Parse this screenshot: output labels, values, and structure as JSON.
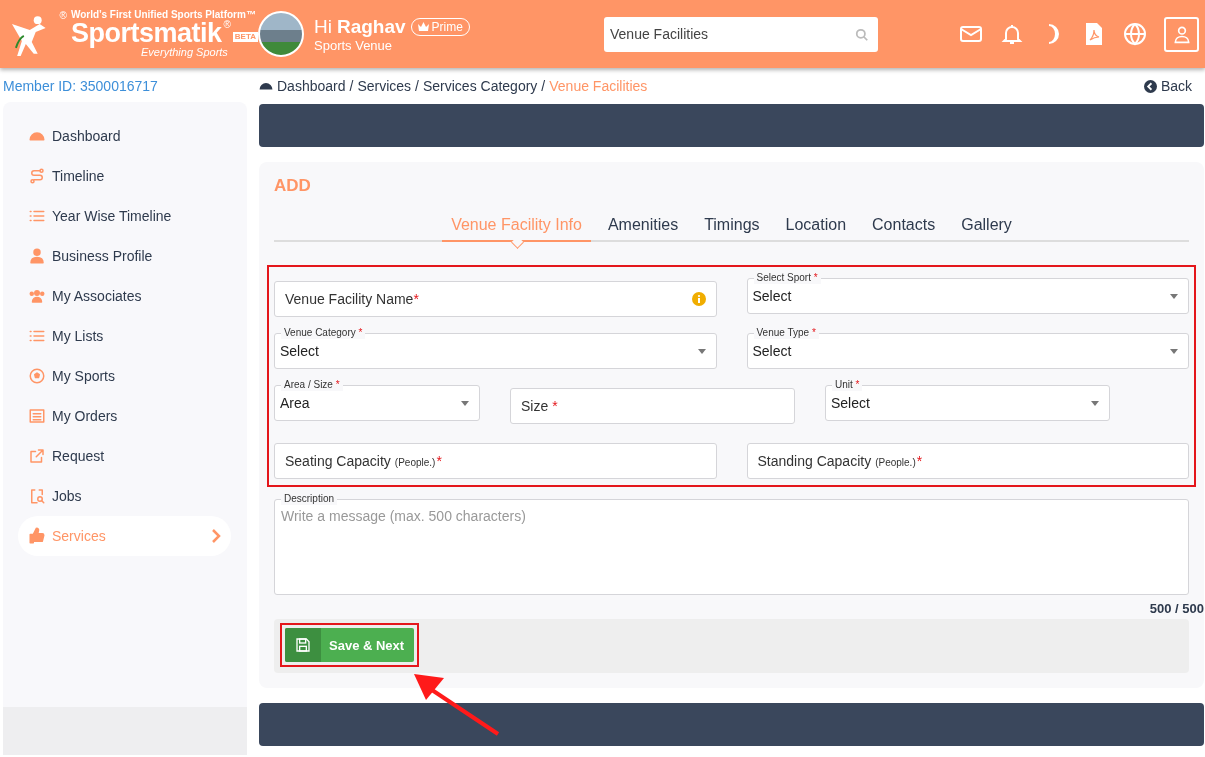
{
  "header": {
    "logo_mark": "®",
    "tagline": "World’s First Unified Sports Platform™",
    "brand": "Sportsmatik",
    "brand_mark": "®",
    "beta": "BETA",
    "slogan": "Everything Sports",
    "greeting": "Hi",
    "user_name": "Raghav",
    "badge": "Prime",
    "role": "Sports Venue",
    "search": {
      "value": "Venue Facilities"
    }
  },
  "member_id": "Member ID: 3500016717",
  "breadcrumb": [
    {
      "label": "Dashboard",
      "current": false
    },
    {
      "label": "Services",
      "current": false
    },
    {
      "label": "Services Category",
      "current": false
    },
    {
      "label": "Venue Facilities",
      "current": true
    }
  ],
  "breadcrumb_separator": "/",
  "back": "Back",
  "sidebar": {
    "items": [
      {
        "label": "Dashboard",
        "selected": false
      },
      {
        "label": "Timeline",
        "selected": false
      },
      {
        "label": "Year Wise Timeline",
        "selected": false
      },
      {
        "label": "Business Profile",
        "selected": false
      },
      {
        "label": "My Associates",
        "selected": false
      },
      {
        "label": "My Lists",
        "selected": false
      },
      {
        "label": "My Sports",
        "selected": false
      },
      {
        "label": "My Orders",
        "selected": false
      },
      {
        "label": "Request",
        "selected": false
      },
      {
        "label": "Jobs",
        "selected": false
      },
      {
        "label": "Services",
        "selected": true
      }
    ]
  },
  "form": {
    "title": "ADD",
    "tabs": [
      {
        "label": "Venue Facility Info",
        "selected": true
      },
      {
        "label": "Amenities",
        "selected": false
      },
      {
        "label": "Timings",
        "selected": false
      },
      {
        "label": "Location",
        "selected": false
      },
      {
        "label": "Contacts",
        "selected": false
      },
      {
        "label": "Gallery",
        "selected": false
      }
    ],
    "rows": [
      {
        "fields": [
          {
            "kind": "text",
            "placeholder": "Venue Facility Name",
            "required": true,
            "info": true
          },
          {
            "kind": "select",
            "label": "Select Sport",
            "required": true,
            "value": "Select"
          }
        ]
      },
      {
        "fields": [
          {
            "kind": "select",
            "label": "Venue Category",
            "required": true,
            "value": "Select"
          },
          {
            "kind": "select",
            "label": "Venue Type",
            "required": true,
            "value": "Select"
          }
        ]
      },
      {
        "fields": [
          {
            "kind": "select",
            "label": "Area / Size",
            "required": true,
            "value": "Area"
          },
          {
            "kind": "text",
            "placeholder": "Size",
            "required": true,
            "info": false
          },
          {
            "kind": "select",
            "label": "Unit",
            "required": true,
            "value": "Select"
          }
        ]
      },
      {
        "fields": [
          {
            "kind": "text",
            "placeholder": "Seating Capacity",
            "hint": "(People.)",
            "required": true,
            "info": false
          },
          {
            "kind": "text",
            "placeholder": "Standing Capacity",
            "hint": "(People.)",
            "required": true,
            "info": false
          }
        ]
      }
    ],
    "required_mark": "*",
    "description": {
      "label": "Description",
      "placeholder": "Write a message (max. 500 characters)",
      "counter": "500 / 500"
    },
    "save_button": "Save & Next"
  }
}
